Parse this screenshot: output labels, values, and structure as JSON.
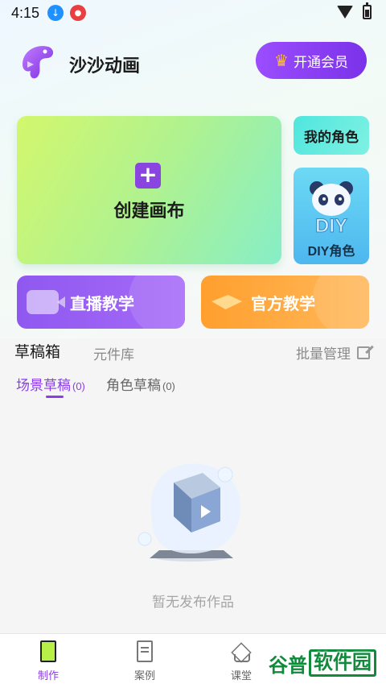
{
  "status_bar": {
    "time": "4:15"
  },
  "header": {
    "title": "沙沙动画",
    "vip_label": "开通会员"
  },
  "cards": {
    "create_label": "创建画布",
    "my_role_label": "我的角色",
    "diy_label": "DIY角色",
    "diy_art_text": "DIY",
    "live_tutorial_label": "直播教学",
    "official_tutorial_label": "官方教学"
  },
  "tabs": {
    "drafts": "草稿箱",
    "library": "元件库",
    "batch_manage": "批量管理"
  },
  "subtabs": [
    {
      "label": "场景草稿",
      "count": "(0)"
    },
    {
      "label": "角色草稿",
      "count": "(0)"
    }
  ],
  "empty_state": {
    "text": "暂无发布作品"
  },
  "bottom_nav": [
    {
      "label": "制作"
    },
    {
      "label": "案例"
    },
    {
      "label": "课堂"
    }
  ],
  "watermark": {
    "text_left": "谷普",
    "text_right": "软件园"
  },
  "colors": {
    "accent": "#8a3fe6",
    "vip_button": "#8b40f0",
    "create_card": "#b6f28c",
    "diy_card": "#5cc8f2",
    "live_tutorial": "#9a60f4",
    "official_tutorial": "#ffab45"
  }
}
